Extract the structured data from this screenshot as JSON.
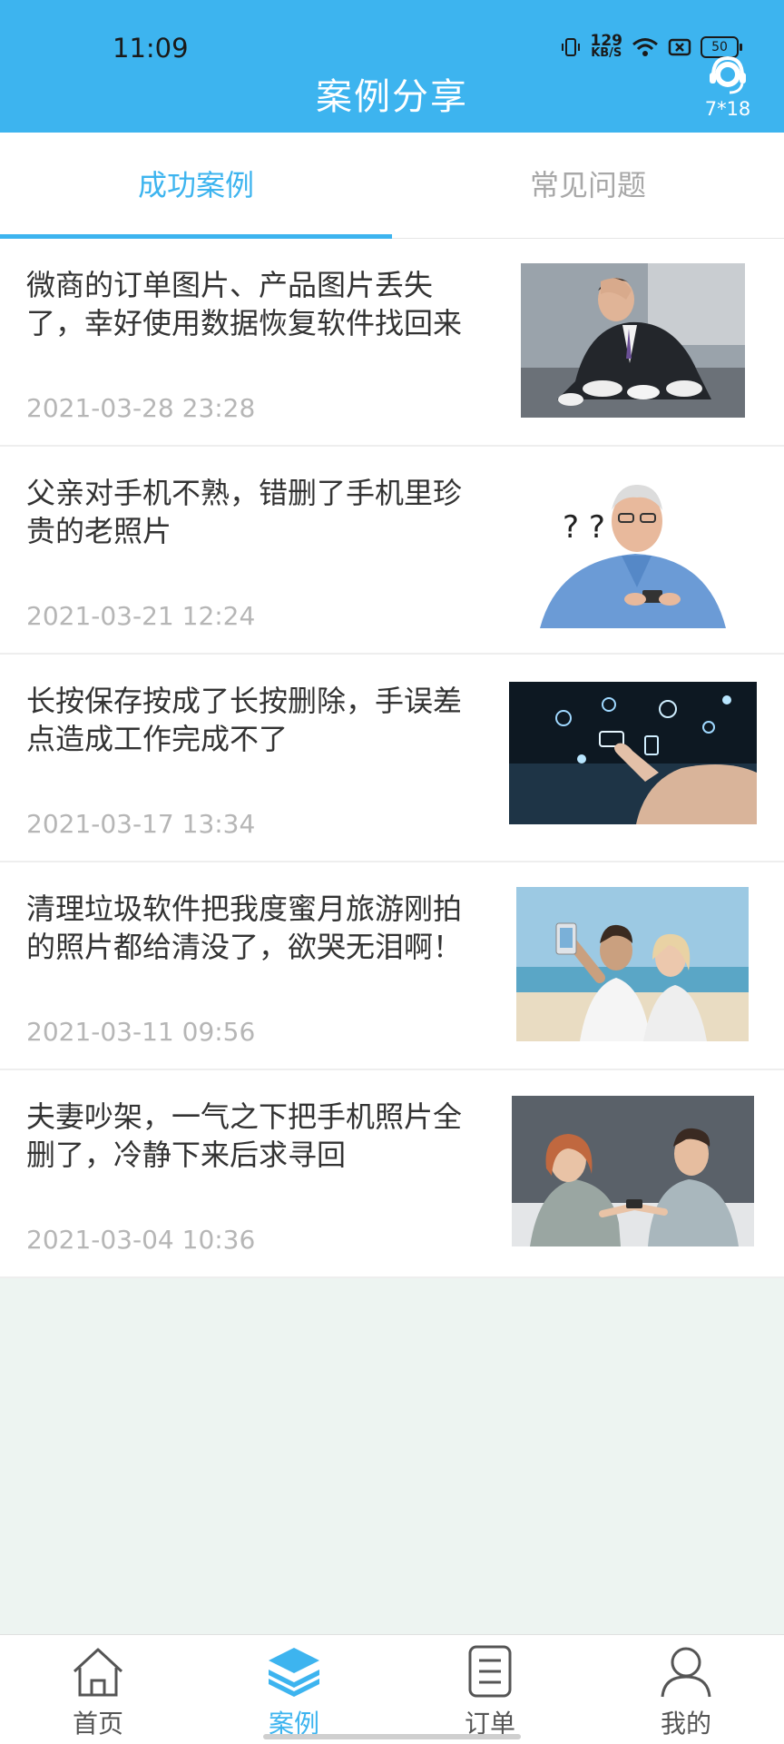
{
  "status_bar": {
    "time": "11:09",
    "net_speed": "129",
    "net_unit": "KB/S",
    "battery": "50"
  },
  "header": {
    "title": "案例分享",
    "support_label": "7*18"
  },
  "tabs": [
    {
      "label": "成功案例",
      "active": true
    },
    {
      "label": "常见问题",
      "active": false
    }
  ],
  "cases": [
    {
      "title": "微商的订单图片、产品图片丢失了，幸好使用数据恢复软件找回来",
      "date": "2021-03-28 23:28",
      "image": "stressed-businessman-photo"
    },
    {
      "title": "父亲对手机不熟，错删了手机里珍贵的老照片",
      "date": "2021-03-21 12:24",
      "image": "confused-elderly-man-photo"
    },
    {
      "title": "长按保存按成了长按删除，手误差点造成工作完成不了",
      "date": "2021-03-17 13:34",
      "image": "touchscreen-apps-photo"
    },
    {
      "title": "清理垃圾软件把我度蜜月旅游刚拍的照片都给清没了，欲哭无泪啊！",
      "date": "2021-03-11 09:56",
      "image": "couple-beach-selfie-photo"
    },
    {
      "title": "夫妻吵架，一气之下把手机照片全删了，冷静下来后求寻回",
      "date": "2021-03-04 10:36",
      "image": "arguing-couple-photo"
    }
  ],
  "bottom_nav": [
    {
      "label": "首页",
      "icon": "home-icon",
      "active": false
    },
    {
      "label": "案例",
      "icon": "layers-icon",
      "active": true
    },
    {
      "label": "订单",
      "icon": "order-list-icon",
      "active": false
    },
    {
      "label": "我的",
      "icon": "profile-icon",
      "active": false
    }
  ],
  "colors": {
    "accent": "#3db4ef",
    "background": "#edf4f1",
    "date_text": "#b6b6b6"
  }
}
